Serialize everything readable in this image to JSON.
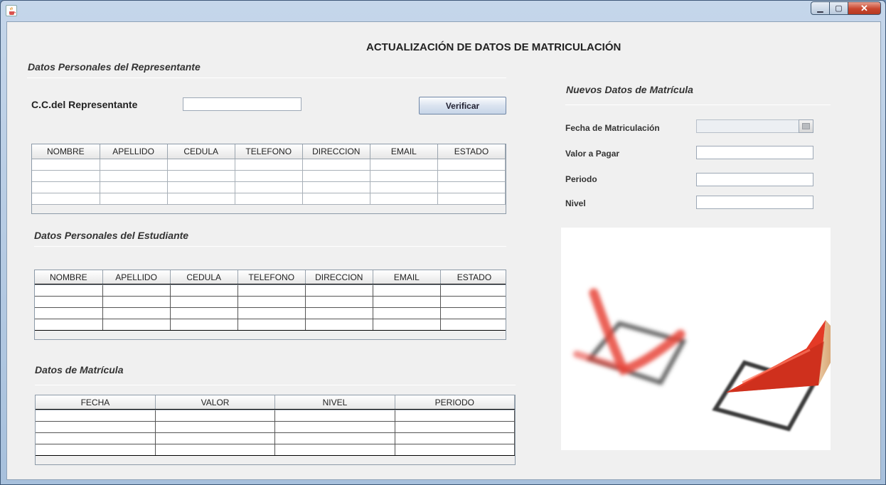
{
  "window": {
    "app_icon": "java-cup-icon",
    "controls": {
      "minimize": "minimize-icon",
      "maximize": "maximize-icon",
      "close": "close-icon"
    }
  },
  "main_title": "ACTUALIZACIÓN DE DATOS DE MATRICULACIÓN",
  "representante": {
    "section_title": "Datos Personales del Representante",
    "cc_label": "C.C.del Representante",
    "cc_value": "",
    "verify_label": "Verificar",
    "table": {
      "columns": [
        "NOMBRE",
        "APELLIDO",
        "CEDULA",
        "TELEFONO",
        "DIRECCION",
        "EMAIL",
        "ESTADO"
      ],
      "rows": [
        [
          "",
          "",
          "",
          "",
          "",
          "",
          ""
        ],
        [
          "",
          "",
          "",
          "",
          "",
          "",
          ""
        ],
        [
          "",
          "",
          "",
          "",
          "",
          "",
          ""
        ],
        [
          "",
          "",
          "",
          "",
          "",
          "",
          ""
        ]
      ]
    }
  },
  "estudiante": {
    "section_title": "Datos Personales del Estudiante",
    "table": {
      "columns": [
        "NOMBRE",
        "APELLIDO",
        "CEDULA",
        "TELEFONO",
        "DIRECCION",
        "EMAIL",
        "ESTADO"
      ],
      "rows": [
        [
          "",
          "",
          "",
          "",
          "",
          "",
          ""
        ],
        [
          "",
          "",
          "",
          "",
          "",
          "",
          ""
        ],
        [
          "",
          "",
          "",
          "",
          "",
          "",
          ""
        ],
        [
          "",
          "",
          "",
          "",
          "",
          "",
          ""
        ]
      ]
    }
  },
  "matricula": {
    "section_title": "Datos de Matrícula",
    "table": {
      "columns": [
        "FECHA",
        "VALOR",
        "NIVEL",
        "PERIODO"
      ],
      "rows": [
        [
          "",
          "",
          "",
          ""
        ],
        [
          "",
          "",
          "",
          ""
        ],
        [
          "",
          "",
          "",
          ""
        ],
        [
          "",
          "",
          "",
          ""
        ]
      ]
    }
  },
  "nuevos": {
    "section_title": "Nuevos Datos de Matrícula",
    "fecha_label": "Fecha de Matriculación",
    "fecha_value": "",
    "valor_label": "Valor a Pagar",
    "valor_value": "",
    "periodo_label": "Periodo",
    "periodo_value": "",
    "nivel_label": "Nivel",
    "nivel_value": "",
    "date_icon": "calendar-icon"
  },
  "image": {
    "subject": "checkbox-checked-with-red-pencil"
  },
  "colors": {
    "title_bar": "#b9cde5",
    "client_bg": "#f0f0f0",
    "separator": "#7d8fae",
    "check_red": "#e8453a",
    "pencil_red": "#e43a26"
  }
}
